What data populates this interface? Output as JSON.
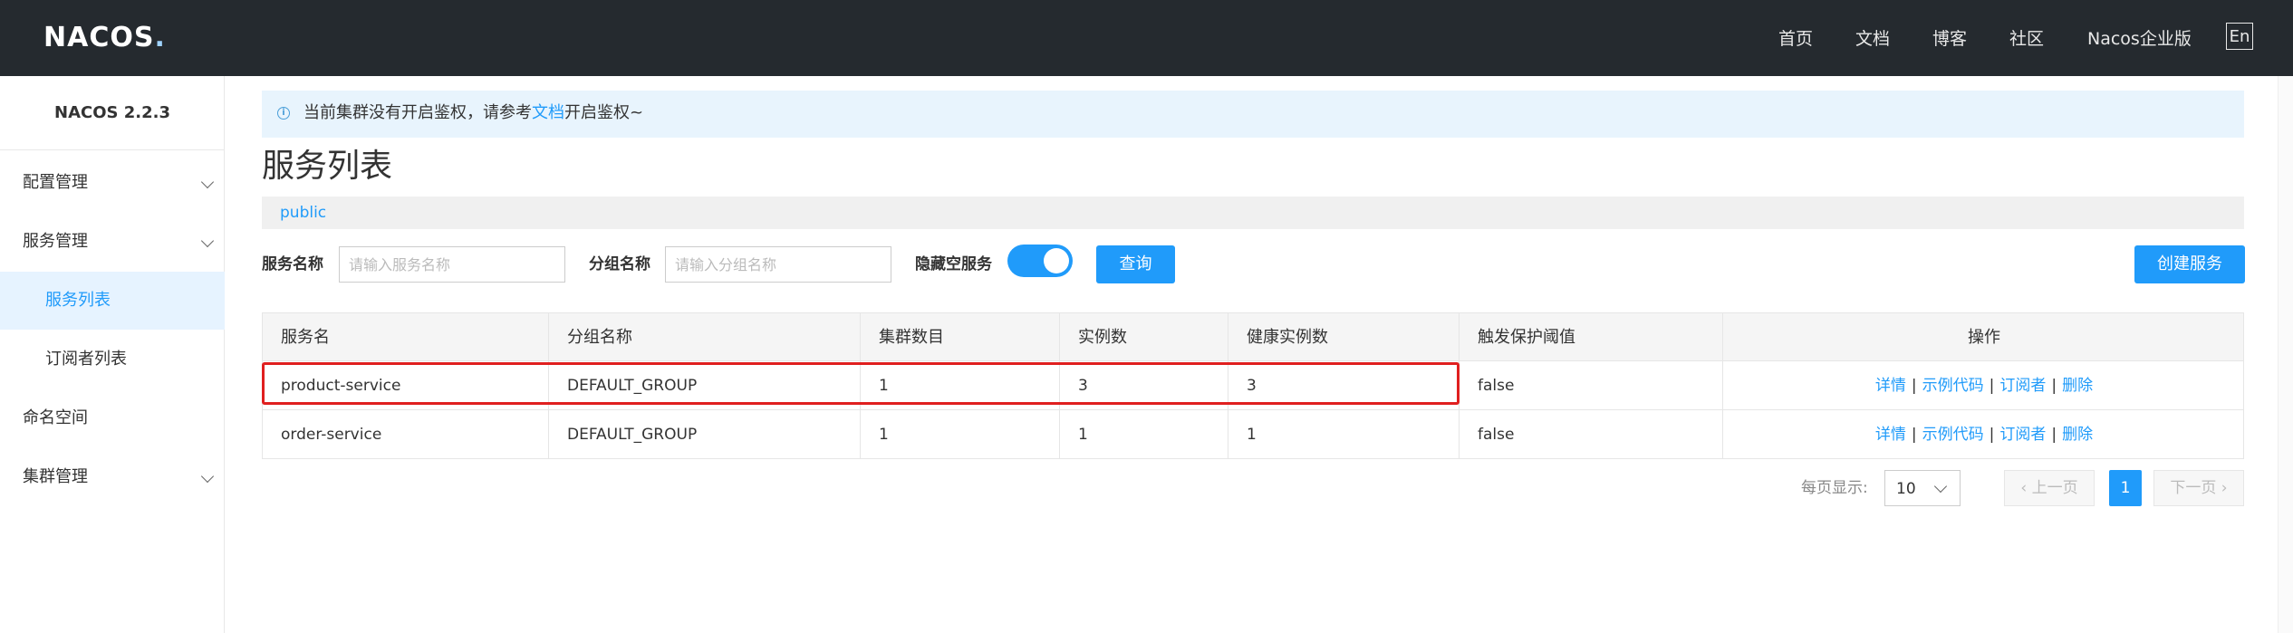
{
  "topbar": {
    "logo_main": "NACOS",
    "logo_tail": ".",
    "nav": [
      "首页",
      "文档",
      "博客",
      "社区",
      "Nacos企业版"
    ],
    "lang_button": "En"
  },
  "sidebar": {
    "version": "NACOS 2.2.3",
    "items": [
      {
        "label": "配置管理"
      },
      {
        "label": "服务管理"
      },
      {
        "label": "服务列表"
      },
      {
        "label": "订阅者列表"
      },
      {
        "label": "命名空间"
      },
      {
        "label": "集群管理"
      }
    ]
  },
  "notice": {
    "prefix": "当前集群没有开启鉴权，请参考",
    "link": "文档",
    "suffix": "开启鉴权~"
  },
  "page": {
    "title": "服务列表",
    "namespace": "public"
  },
  "filter": {
    "service_label": "服务名称",
    "service_placeholder": "请输入服务名称",
    "group_label": "分组名称",
    "group_placeholder": "请输入分组名称",
    "hide_empty_label": "隐藏空服务",
    "hide_empty_on": true,
    "query_button": "查询",
    "create_button": "创建服务"
  },
  "table": {
    "headers": [
      "服务名",
      "分组名称",
      "集群数目",
      "实例数",
      "健康实例数",
      "触发保护阈值",
      "操作"
    ],
    "rows": [
      {
        "name": "product-service",
        "group": "DEFAULT_GROUP",
        "clusters": "1",
        "instances": "3",
        "healthy": "3",
        "threshold": "false"
      },
      {
        "name": "order-service",
        "group": "DEFAULT_GROUP",
        "clusters": "1",
        "instances": "1",
        "healthy": "1",
        "threshold": "false"
      }
    ],
    "ops": [
      "详情",
      "示例代码",
      "订阅者",
      "删除"
    ],
    "op_separator": "|"
  },
  "pagination": {
    "per_page_label": "每页显示:",
    "per_page_value": "10",
    "prev": "上一页",
    "next": "下一页",
    "current_page": "1"
  },
  "colors": {
    "accent": "#209bfa",
    "topbar": "#252a2f",
    "highlight": "#e01f1f"
  }
}
